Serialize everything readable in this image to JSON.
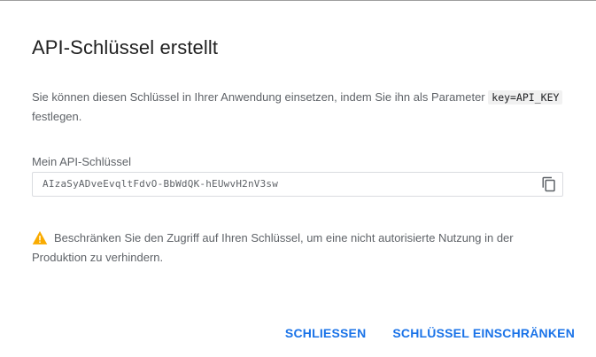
{
  "dialog": {
    "title": "API-Schlüssel erstellt",
    "desc_part1": "Sie können diesen Schlüssel in Ihrer Anwendung einsetzen, indem Sie ihn als Parameter",
    "desc_code": "key=API_KEY",
    "desc_part2": "festlegen.",
    "key_label": "Mein API-Schlüssel",
    "key_value": "AIzaSyADveEvqltFdvO-BbWdQK-hEUwvH2nV3sw",
    "copy_icon": "content-copy-icon",
    "warning_icon": "warning-triangle-icon",
    "warning_text": "Beschränken Sie den Zugriff auf Ihren Schlüssel, um eine nicht autorisierte Nutzung in der Produktion zu verhindern.",
    "close_label": "SCHLIESSEN",
    "restrict_label": "SCHLÜSSEL EINSCHRÄNKEN"
  },
  "colors": {
    "accent": "#1a73e8",
    "warning": "#f9ab00"
  }
}
